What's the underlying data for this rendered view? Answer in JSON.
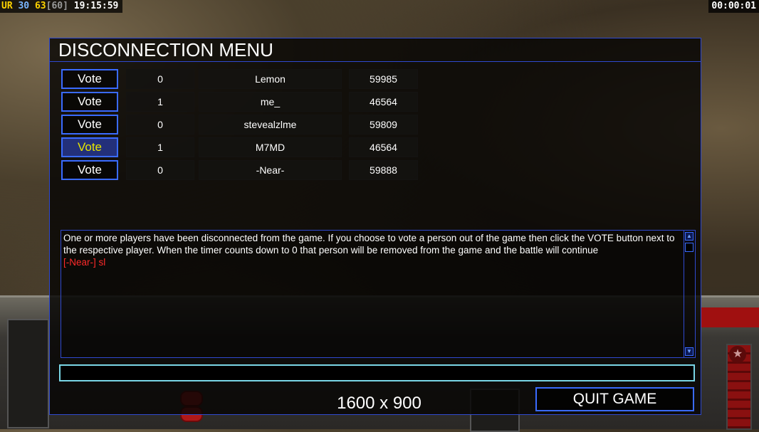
{
  "hud_top": {
    "ur": "UR",
    "n30": "30",
    "n63": "63",
    "n60": "[60]",
    "clock": "19:15:59",
    "timer": "00:00:01"
  },
  "dialog": {
    "title": "DISCONNECTION MENU",
    "players": [
      {
        "vote_label": "Vote",
        "votes": "0",
        "name": "Lemon",
        "value": "59985"
      },
      {
        "vote_label": "Vote",
        "votes": "1",
        "name": "me_",
        "value": "46564"
      },
      {
        "vote_label": "Vote",
        "votes": "0",
        "name": "stevealzlme",
        "value": "59809"
      },
      {
        "vote_label": "Vote",
        "votes": "1",
        "name": "M7MD",
        "value": "46564"
      },
      {
        "vote_label": "Vote",
        "votes": "0",
        "name": "-Near-",
        "value": "59888"
      }
    ],
    "message": "One or more players have been disconnected from the game. If you choose to vote a person out of the game then click the VOTE button next to the respective player. When the timer counts down to 0 that person will be removed from the game and the battle will continue",
    "chat_line": "[-Near-] sl",
    "chat_input_value": "",
    "resolution": "1600 x 900",
    "quit_label": "QUIT GAME"
  },
  "colors": {
    "border_blue": "#2f49d0",
    "input_cyan": "#7ad6e6",
    "chat_red": "#ff2a2a",
    "highlight_yellow": "#e6e600"
  },
  "icons": {
    "scroll_up": "scroll-up-arrow-icon",
    "scroll_down": "scroll-down-arrow-icon"
  }
}
